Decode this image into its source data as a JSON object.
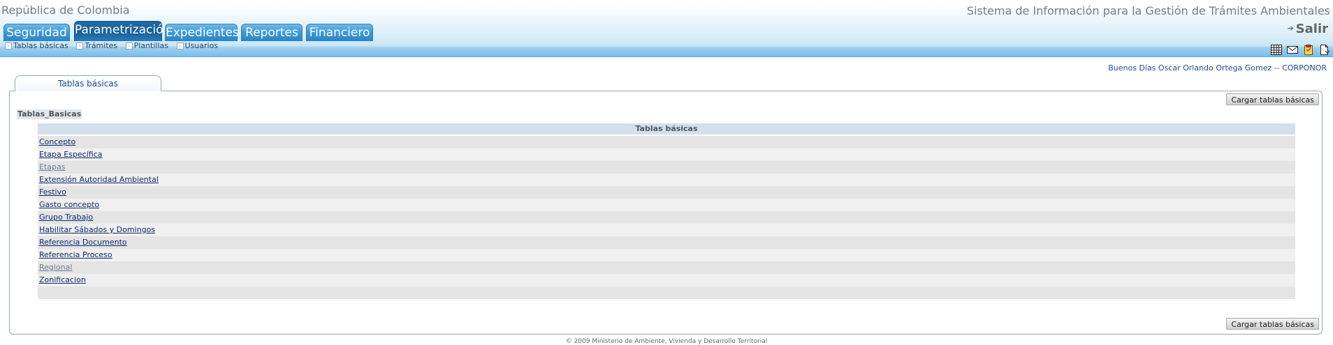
{
  "header": {
    "country": "República de Colombia",
    "system_title": "Sistema de Información para la Gestión de Trámites Ambientales",
    "tabs": [
      {
        "label": "Seguridad",
        "active": false
      },
      {
        "label": "Parametrización",
        "active": true
      },
      {
        "label": "Expedientes",
        "active": false
      },
      {
        "label": "Reportes",
        "active": false
      },
      {
        "label": "Financiero",
        "active": false
      }
    ],
    "logout_label": "Salir",
    "subnav": [
      "Tablas básicas",
      "Trámites",
      "Plantillas",
      "Usuarios"
    ],
    "tool_icons": [
      "calendar-icon",
      "mail-icon",
      "clipboard-icon",
      "document-icon"
    ]
  },
  "greeting": "Buenos Días Oscar Orlando Ortega Gomez -- CORPONOR",
  "panel": {
    "tab_label": "Tablas básicas",
    "load_button_label": "Cargar tablas básicas",
    "section_title": "Tablas_Basicas",
    "table_header": "Tablas básicas",
    "rows": [
      {
        "label": "Concepto",
        "visited": false
      },
      {
        "label": "Etapa Específica",
        "visited": false
      },
      {
        "label": "Etapas",
        "visited": true
      },
      {
        "label": "Extensión Autoridad Ambiental",
        "visited": false
      },
      {
        "label": "Festivo",
        "visited": false
      },
      {
        "label": "Gasto concepto",
        "visited": false
      },
      {
        "label": "Grupo Trabajo",
        "visited": false
      },
      {
        "label": "Habilitar Sábados y Domingos",
        "visited": false
      },
      {
        "label": "Referencia Documento",
        "visited": false
      },
      {
        "label": "Referencia Proceso",
        "visited": false
      },
      {
        "label": "Regional",
        "visited": true
      },
      {
        "label": "Zonificacion",
        "visited": false
      }
    ]
  },
  "footer": "© 2009 Ministerio de Ambiente, Vivienda y Desarrollo Territorial"
}
